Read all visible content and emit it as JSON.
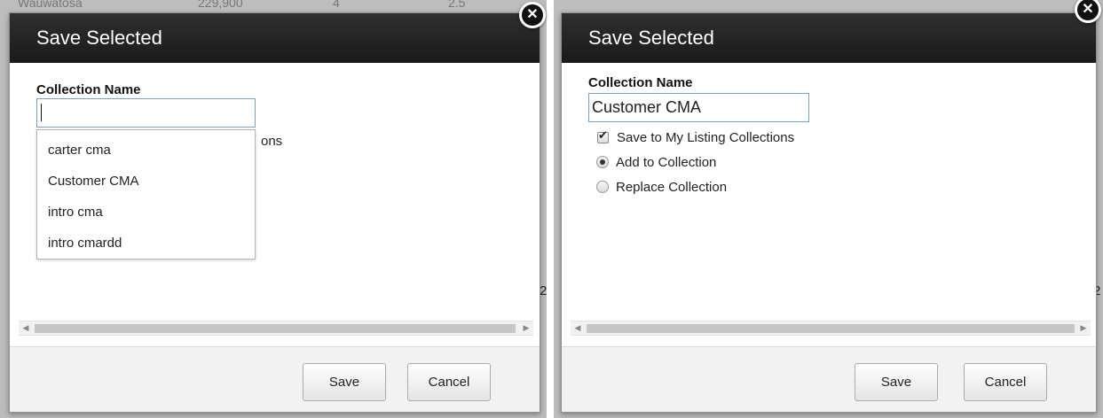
{
  "background": {
    "left_header_text": "Wauwatosa",
    "left_header_price": "229,900",
    "left_header_beds": "4",
    "left_header_baths": "2.5",
    "edge_glyph": "2"
  },
  "left_dialog": {
    "title": "Save Selected",
    "collection_label": "Collection Name",
    "collection_value": "",
    "partial_text": "ons",
    "autocomplete_options": [
      "carter cma",
      "Customer CMA",
      "intro cma",
      "intro cmardd"
    ],
    "save_label": "Save",
    "cancel_label": "Cancel"
  },
  "right_dialog": {
    "title": "Save Selected",
    "collection_label": "Collection Name",
    "collection_value": "Customer CMA",
    "save_to_collections_label": "Save to My Listing Collections",
    "save_to_collections_checked": true,
    "add_to_collection_label": "Add to Collection",
    "replace_collection_label": "Replace Collection",
    "selected_mode": "Add to Collection",
    "save_label": "Save",
    "cancel_label": "Cancel"
  },
  "icons": {
    "close": "close-icon",
    "check": "checkmark-icon",
    "scroll_left": "chevron-left-icon",
    "scroll_right": "chevron-right-icon"
  },
  "colors": {
    "header_bg": "#1e1e1e",
    "input_focus_border": "#6aa2d8",
    "footer_bg": "#f2f2f2"
  }
}
